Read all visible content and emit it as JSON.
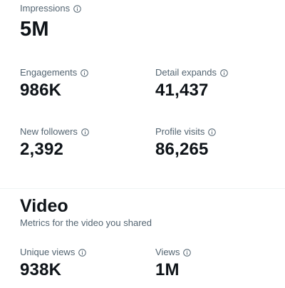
{
  "metrics": {
    "impressions": {
      "label": "Impressions",
      "value": "5M"
    },
    "engagements": {
      "label": "Engagements",
      "value": "986K"
    },
    "detail_expands": {
      "label": "Detail expands",
      "value": "41,437"
    },
    "new_followers": {
      "label": "New followers",
      "value": "2,392"
    },
    "profile_visits": {
      "label": "Profile visits",
      "value": "86,265"
    }
  },
  "video": {
    "title": "Video",
    "subtitle": "Metrics for the video you shared",
    "unique_views": {
      "label": "Unique views",
      "value": "938K"
    },
    "views": {
      "label": "Views",
      "value": "1M"
    }
  },
  "icons": {
    "info": "info-circle-icon"
  },
  "colors": {
    "text_primary": "#0f1419",
    "text_secondary": "#536471",
    "divider": "#eff3f4"
  }
}
